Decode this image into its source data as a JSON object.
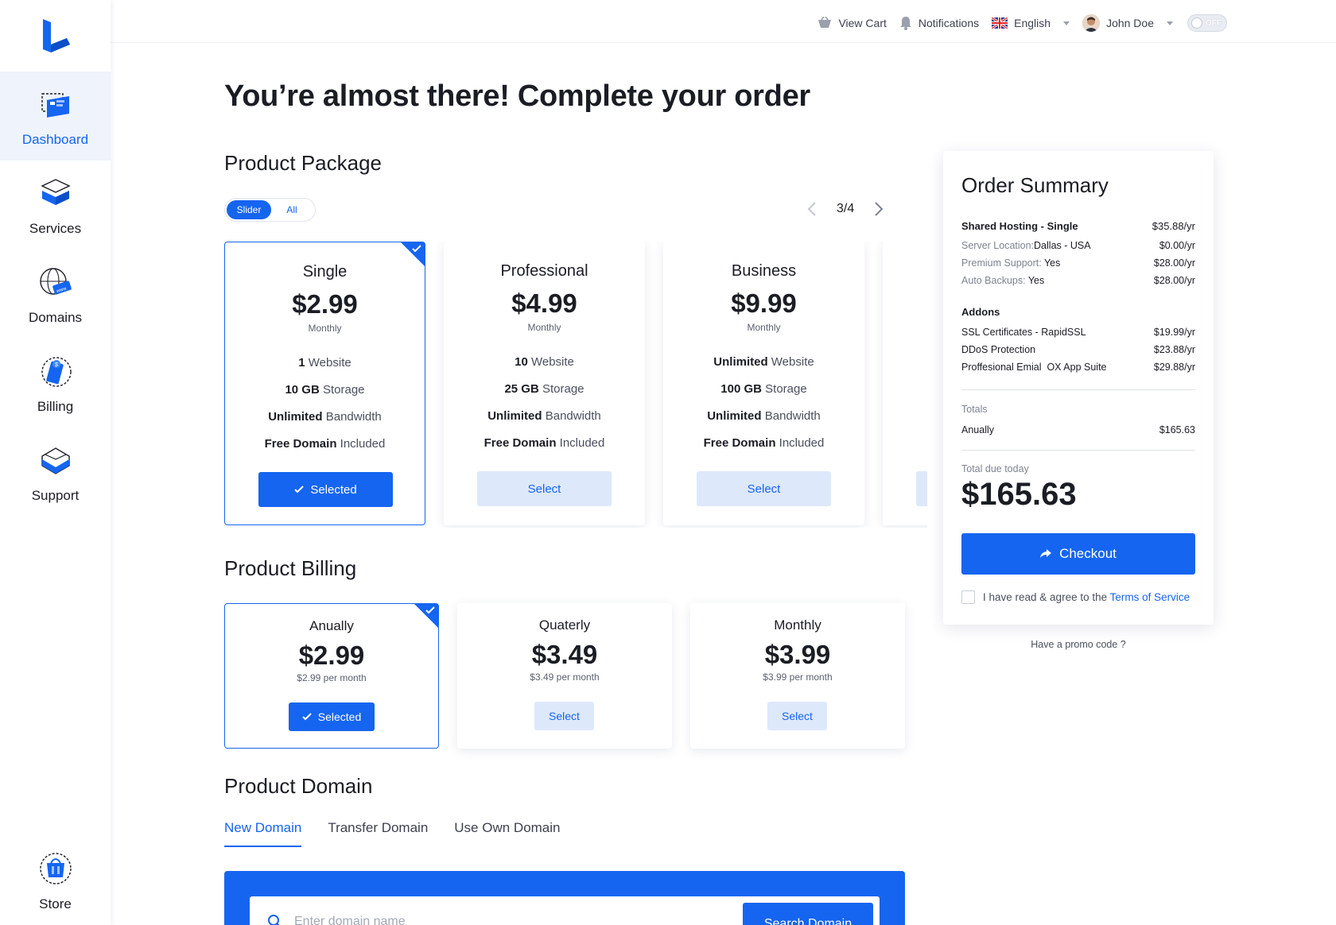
{
  "colors": {
    "accent": "#1565f0",
    "accent_light": "#dde8fb",
    "active_bg": "#eef3fc"
  },
  "sidebar": {
    "logo_icon": "brand-logo-icon",
    "items": [
      {
        "label": "Dashboard",
        "icon": "dashboard-icon",
        "active": true
      },
      {
        "label": "Services",
        "icon": "services-icon"
      },
      {
        "label": "Domains",
        "icon": "domains-icon"
      },
      {
        "label": "Billing",
        "icon": "billing-icon"
      },
      {
        "label": "Support",
        "icon": "support-icon"
      },
      {
        "label": "Store",
        "icon": "store-icon"
      }
    ]
  },
  "topbar": {
    "cart": "View Cart",
    "notifications": "Notifications",
    "language": "English",
    "user": "John Doe",
    "toggle": "OFF"
  },
  "main": {
    "title": "You’re almost there! Complete your order",
    "package_section": "Product Package",
    "view_toggle": {
      "slider": "Slider",
      "all": "All"
    },
    "pager": "3/4",
    "packages": [
      {
        "name": "Single",
        "price": "$2.99",
        "period": "Monthly",
        "features": [
          [
            "1",
            "Website"
          ],
          [
            "10 GB",
            "Storage"
          ],
          [
            "Unlimited",
            "Bandwidth"
          ],
          [
            "Free Domain",
            "Included"
          ]
        ],
        "button": "Selected",
        "selected": true
      },
      {
        "name": "Professional",
        "price": "$4.99",
        "period": "Monthly",
        "features": [
          [
            "10",
            "Website"
          ],
          [
            "25 GB",
            "Storage"
          ],
          [
            "Unlimited",
            "Bandwidth"
          ],
          [
            "Free Domain",
            "Included"
          ]
        ],
        "button": "Select"
      },
      {
        "name": "Business",
        "price": "$9.99",
        "period": "Monthly",
        "features": [
          [
            "Unlimited",
            "Website"
          ],
          [
            "100 GB",
            "Storage"
          ],
          [
            "Unlimited",
            "Bandwidth"
          ],
          [
            "Free Domain",
            "Included"
          ]
        ],
        "button": "Select"
      }
    ],
    "billing_section": "Product Billing",
    "billing": [
      {
        "name": "Anually",
        "price": "$2.99",
        "sub": "$2.99 per month",
        "button": "Selected",
        "selected": true
      },
      {
        "name": "Quaterly",
        "price": "$3.49",
        "sub": "$3.49 per month",
        "button": "Select"
      },
      {
        "name": "Monthly",
        "price": "$3.99",
        "sub": "$3.99 per month",
        "button": "Select"
      }
    ],
    "domain_section": "Product Domain",
    "domain_tabs": [
      "New Domain",
      "Transfer Domain",
      "Use Own Domain"
    ],
    "domain_placeholder": "Enter domain name",
    "search_button": "Search Domain"
  },
  "summary": {
    "title": "Order Summary",
    "product": {
      "label": "Shared Hosting - Single",
      "price": "$35.88/yr"
    },
    "details": [
      {
        "key": "Server Location:",
        "val": "Dallas - USA",
        "price": "$0.00/yr"
      },
      {
        "key": "Premium Support:",
        "val": "Yes",
        "price": "$28.00/yr"
      },
      {
        "key": "Auto Backups:",
        "val": "Yes",
        "price": "$28.00/yr"
      }
    ],
    "addons_title": "Addons",
    "addons": [
      {
        "label": "SSL Certificates - RapidSSL",
        "price": "$19.99/yr"
      },
      {
        "label": "DDoS Protection",
        "price": "$23.88/yr"
      },
      {
        "label": "Proffesional Emial  OX App Suite",
        "price": "$29.88/yr"
      }
    ],
    "totals_label": "Totals",
    "totals_row": {
      "label": "Anually",
      "price": "$165.63"
    },
    "due_label": "Total due today",
    "due_value": "$165.63",
    "checkout": "Checkout",
    "tos_text": "I have read & agree to the",
    "tos_link": "Terms of Service",
    "promo": "Have a promo code ?"
  }
}
